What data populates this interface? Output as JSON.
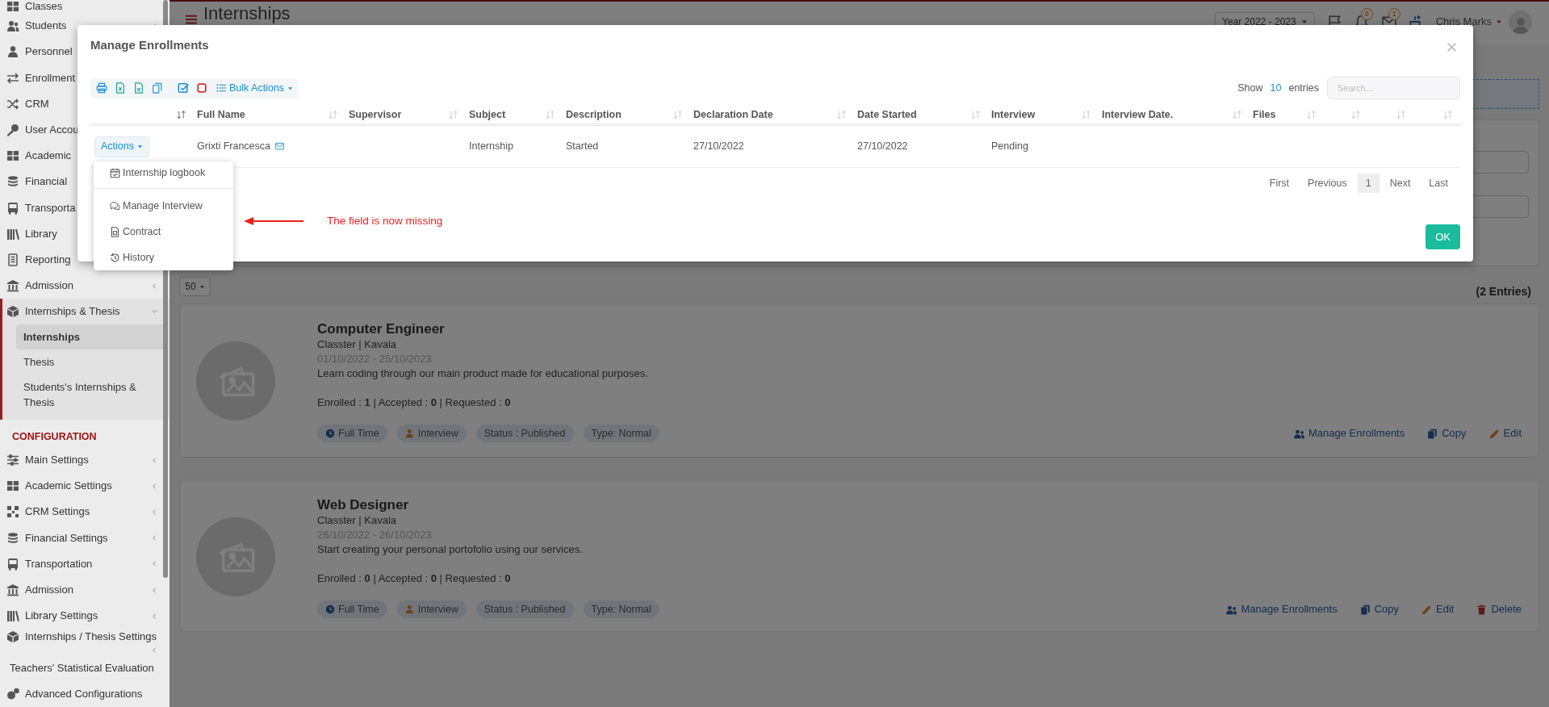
{
  "header": {
    "title": "Internships",
    "year_select": "Year 2022 - 2023",
    "notifications_badge": "0",
    "messages_badge": "1",
    "user_name": "Chris Marks"
  },
  "sidebar": {
    "items": [
      {
        "kind": "item",
        "label": "Classes",
        "submenu": false
      },
      {
        "kind": "item",
        "label": "Students",
        "submenu": true
      },
      {
        "kind": "item",
        "label": "Personnel",
        "submenu": false
      },
      {
        "kind": "item",
        "label": "Enrollment",
        "submenu": false
      },
      {
        "kind": "item",
        "label": "CRM",
        "submenu": false
      },
      {
        "kind": "item",
        "label": "User Accou",
        "submenu": false
      },
      {
        "kind": "item",
        "label": "Academic",
        "submenu": false
      },
      {
        "kind": "item",
        "label": "Financial",
        "submenu": false
      },
      {
        "kind": "item",
        "label": "Transporta",
        "submenu": false
      },
      {
        "kind": "item",
        "label": "Library",
        "submenu": false
      },
      {
        "kind": "item",
        "label": "Reporting",
        "submenu": false
      },
      {
        "kind": "item",
        "label": "Admission",
        "submenu": true
      },
      {
        "kind": "group",
        "label": "Internships & Thesis",
        "expanded": true,
        "children": [
          {
            "label": "Internships",
            "selected": true
          },
          {
            "label": "Thesis",
            "selected": false
          },
          {
            "label": "Students's Internships & Thesis",
            "selected": false
          }
        ]
      },
      {
        "kind": "heading",
        "label": "CONFIGURATION"
      },
      {
        "kind": "item",
        "label": "Main Settings",
        "submenu": true
      },
      {
        "kind": "item",
        "label": "Academic Settings",
        "submenu": true
      },
      {
        "kind": "item",
        "label": "CRM Settings",
        "submenu": true
      },
      {
        "kind": "item",
        "label": "Financial Settings",
        "submenu": true
      },
      {
        "kind": "item",
        "label": "Transportation",
        "submenu": true
      },
      {
        "kind": "item",
        "label": "Admission",
        "submenu": true
      },
      {
        "kind": "item",
        "label": "Library Settings",
        "submenu": true
      },
      {
        "kind": "item",
        "label": "Internships / Thesis Settings",
        "submenu": true
      },
      {
        "kind": "item",
        "label": "Teachers' Statistical Evaluation",
        "submenu": false
      },
      {
        "kind": "item",
        "label": "Advanced Configurations",
        "submenu": false
      }
    ]
  },
  "content": {
    "page_size": "50",
    "entries_count": "(2 Entries)",
    "cards": [
      {
        "title": "Computer Engineer",
        "organization": "Classter | Kavala",
        "dates": "01/10/2022 - 25/10/2023",
        "description": "Learn coding through our main product made for educational purposes.",
        "stats": "Enrolled : **1** | Accepted : **0** | Requested : **0**",
        "tags": [
          {
            "kind": "schedule",
            "label": "Full Time"
          },
          {
            "kind": "interview",
            "label": "Interview"
          },
          {
            "kind": "status",
            "label": "Status : Published"
          },
          {
            "kind": "type",
            "label": "Type: Normal"
          }
        ],
        "actions": [
          {
            "kind": "manage",
            "label": "Manage Enrollments"
          },
          {
            "kind": "copy",
            "label": "Copy"
          },
          {
            "kind": "edit",
            "label": "Edit"
          }
        ]
      },
      {
        "title": "Web Designer",
        "organization": "Classter | Kavala",
        "dates": "26/10/2022 - 26/10/2023",
        "description": "Start creating your personal portofolio using our services.",
        "stats": "Enrolled : **0** | Accepted : **0** | Requested : **0**",
        "tags": [
          {
            "kind": "schedule",
            "label": "Full Time"
          },
          {
            "kind": "interview",
            "label": "Interview"
          },
          {
            "kind": "status",
            "label": "Status : Published"
          },
          {
            "kind": "type",
            "label": "Type: Normal"
          }
        ],
        "actions": [
          {
            "kind": "manage",
            "label": "Manage Enrollments"
          },
          {
            "kind": "copy",
            "label": "Copy"
          },
          {
            "kind": "edit",
            "label": "Edit"
          },
          {
            "kind": "delete",
            "label": "Delete"
          }
        ]
      }
    ]
  },
  "modal": {
    "title": "Manage Enrollments",
    "bulk_actions": "Bulk Actions",
    "show_label": "Show",
    "page_length": "10",
    "entries_label": "entries",
    "search": {
      "placeholder": "Search..."
    },
    "columns": [
      {
        "sorted": true
      },
      {
        "label": "Full Name",
        "sorted": false
      },
      {
        "label": "Supervisor",
        "sorted": false
      },
      {
        "label": "Subject",
        "sorted": false
      },
      {
        "label": "Description",
        "sorted": false
      },
      {
        "label": "Declaration Date",
        "sorted": false
      },
      {
        "label": "Date Started",
        "sorted": false
      },
      {
        "label": "Interview",
        "sorted": false
      },
      {
        "label": "Interview Date.",
        "sorted": false
      },
      {
        "label": "Files",
        "sorted": false
      },
      {
        "sorted": false
      },
      {
        "sorted": false
      },
      {
        "sorted": false
      }
    ],
    "rows": [
      {
        "menu_open": true,
        "has_email": true,
        "cells": [
          "Actions",
          "Grixti Francesca",
          "",
          "Internship",
          "Started",
          "27/10/2022",
          "27/10/2022",
          "Pending",
          "",
          "",
          "",
          "",
          ""
        ]
      }
    ],
    "actions_menu": {
      "items": [
        {
          "label": "Internship logbook"
        },
        {
          "label": "Manage Interview"
        },
        {
          "label": "Contract"
        },
        {
          "label": "History"
        }
      ]
    },
    "pagination": [
      {
        "label": "First",
        "selected": false
      },
      {
        "label": "Previous",
        "selected": false
      },
      {
        "label": "1",
        "selected": true
      },
      {
        "label": "Next",
        "selected": false
      },
      {
        "label": "Last",
        "selected": false
      }
    ],
    "ok_button": "OK"
  },
  "annotation": {
    "text": "The field is now missing"
  }
}
